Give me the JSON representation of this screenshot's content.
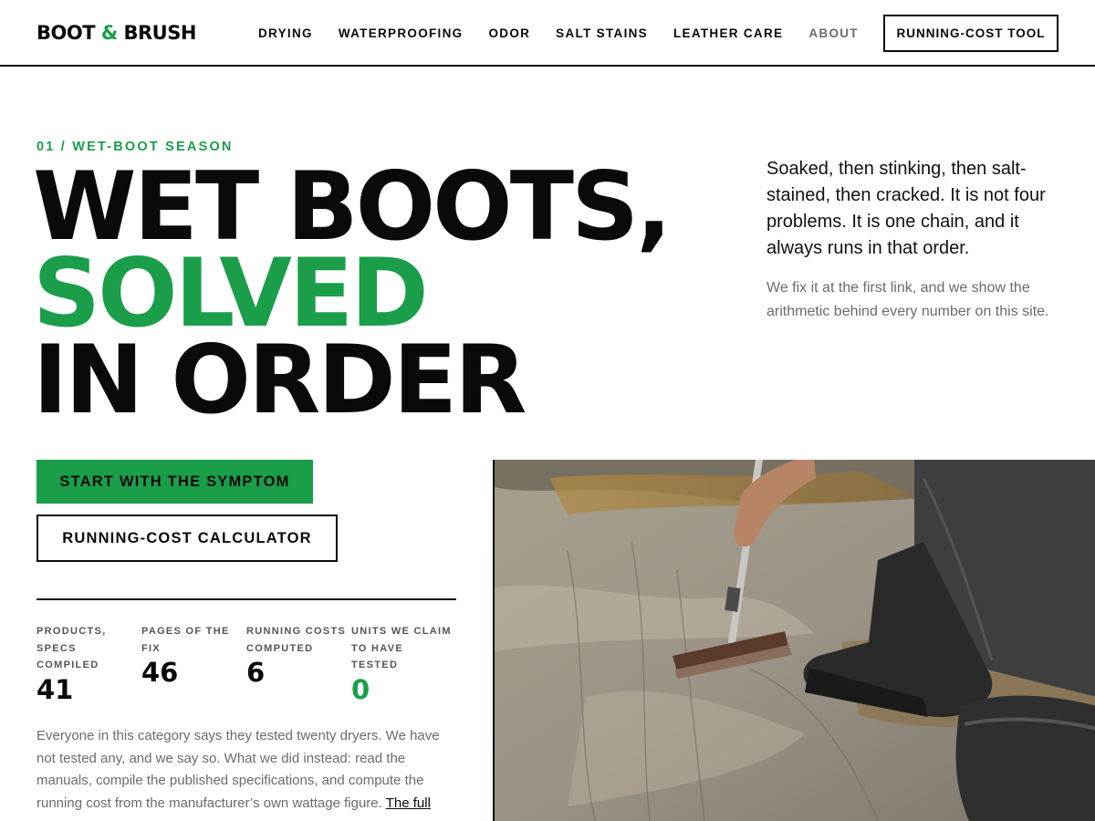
{
  "brand": {
    "name_part1": "BOOT ",
    "ampersand": "&",
    "name_part2": " BRUSH",
    "accent_color": "#1a9e4a"
  },
  "nav": {
    "items": [
      {
        "label": "DRYING"
      },
      {
        "label": "WATERPROOFING"
      },
      {
        "label": "ODOR"
      },
      {
        "label": "SALT STAINS"
      },
      {
        "label": "LEATHER CARE"
      },
      {
        "label": "ABOUT"
      }
    ],
    "cta_label": "RUNNING-COST TOOL"
  },
  "hero": {
    "eyebrow": "01 / WET-BOOT SEASON",
    "headline_line1": "WET BOOTS,",
    "headline_line2": "SOLVED",
    "headline_line3": "IN ORDER",
    "lede": "Soaked, then stinking, then salt-stained, then cracked. It is not four problems. It is one chain, and it always runs in that order.",
    "sublede": "We fix it at the first link, and we show the arithmetic behind every number on this site."
  },
  "actions": {
    "primary_label": "START WITH THE SYMPTOM",
    "secondary_label": "RUNNING-COST CALCULATOR"
  },
  "stats": [
    {
      "label": "PRODUCTS, SPECS COMPILED",
      "value": "41"
    },
    {
      "label": "PAGES OF THE FIX",
      "value": "46"
    },
    {
      "label": "RUNNING COSTS COMPUTED",
      "value": "6"
    },
    {
      "label": "UNITS WE CLAIM TO HAVE TESTED",
      "value": "0"
    }
  ],
  "body": {
    "text": "Everyone in this category says they tested twenty dryers. We have not tested any, and we say so. What we did instead: read the manuals, compile the published specifications, and compute the running cost from the manufacturer’s own wattage figure. ",
    "link_label": "The full"
  },
  "photo": {
    "subject": "person-scrubbing-muddy-boots-image"
  }
}
